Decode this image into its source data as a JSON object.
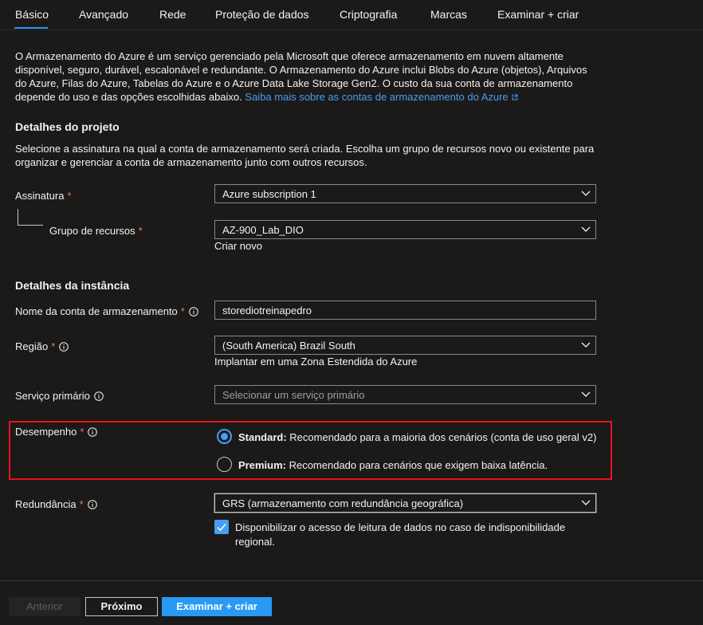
{
  "tabs": [
    {
      "label": "Básico",
      "active": true
    },
    {
      "label": "Avançado"
    },
    {
      "label": "Rede"
    },
    {
      "label": "Proteção de dados"
    },
    {
      "label": "Criptografia"
    },
    {
      "label": "Marcas"
    },
    {
      "label": "Examinar + criar"
    }
  ],
  "intro": {
    "text": "O Armazenamento do Azure é um serviço gerenciado pela Microsoft que oferece armazenamento em nuvem altamente disponível, seguro, durável, escalonável e redundante. O Armazenamento do Azure inclui Blobs do Azure (objetos), Arquivos do Azure, Filas do Azure, Tabelas do Azure e o Azure Data Lake Storage Gen2. O custo da sua conta de armazenamento depende do uso e das opções escolhidas abaixo.",
    "link": "Saiba mais sobre as contas de armazenamento do Azure"
  },
  "project": {
    "title": "Detalhes do projeto",
    "description": "Selecione a assinatura na qual a conta de armazenamento será criada. Escolha um grupo de recursos novo ou existente para organizar e gerenciar a conta de armazenamento junto com outros recursos.",
    "subscription_label": "Assinatura",
    "subscription_value": "Azure subscription 1",
    "resource_group_label": "Grupo de recursos",
    "resource_group_value": "AZ-900_Lab_DIO",
    "create_new": "Criar novo"
  },
  "instance": {
    "title": "Detalhes da instância",
    "account_name_label": "Nome da conta de armazenamento",
    "account_name_value": "storediotreinapedro",
    "region_label": "Região",
    "region_value": "(South America) Brazil South",
    "edge_zone_link": "Implantar em uma Zona Estendida do Azure",
    "primary_service_label": "Serviço primário",
    "primary_service_placeholder": "Selecionar um serviço primário",
    "performance_label": "Desempenho",
    "performance_options": [
      {
        "name": "Standard:",
        "description": " Recomendado para a maioria dos cenários (conta de uso geral v2)",
        "selected": true
      },
      {
        "name": "Premium:",
        "description": " Recomendado para cenários que exigem baixa latência.",
        "selected": false
      }
    ],
    "redundancy_label": "Redundância",
    "redundancy_value": "GRS (armazenamento com redundância geográfica)",
    "read_access_label": "Disponibilizar o acesso de leitura de dados no caso de indisponibilidade regional.",
    "read_access_checked": true
  },
  "required_marker": "*",
  "footer": {
    "previous": "Anterior",
    "next": "Próximo",
    "review": "Examinar + criar"
  },
  "colors": {
    "background": "#1b1a19",
    "accent": "#2899f5",
    "link": "#479ef5",
    "required": "#f1707b",
    "highlight_border": "#e81123"
  }
}
